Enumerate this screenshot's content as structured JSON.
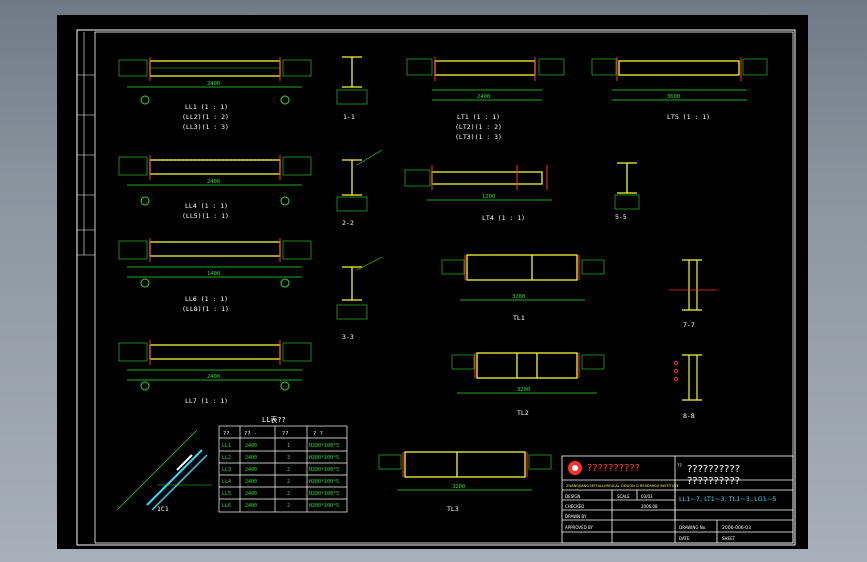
{
  "drawing": {
    "beam_labels": {
      "ll1": "LL1 (1 : 1)",
      "ll2": "(LL2)(1 : 2)",
      "ll3": "(LL3)(1 : 3)",
      "ll4": "LL4 (1 : 1)",
      "ll5": "(LL5)(1 : 1)",
      "ll6": "LL6 (1 : 1)",
      "ll8": "(LL8)(1 : 1)",
      "ll7": "LL7 (1 : 1)",
      "lt1": "LT1 (1 : 1)",
      "lt2": "(LT2)(1 : 2)",
      "lt3": "(LT3)(1 : 3)",
      "lt4": "LT4 (1 : 1)",
      "lt5": "LT5 (1 : 1)"
    },
    "section_labels": {
      "s11": "1-1",
      "s22": "2-2",
      "s33": "3-3",
      "s55": "5-5",
      "s77": "7-7",
      "s88": "8-8"
    },
    "truss_labels": {
      "tl1": "TL1",
      "tl2": "TL2",
      "tl3": "TL3"
    },
    "table": {
      "title": "LL表??",
      "headers": [
        "??",
        "?? -",
        "??",
        "? ?"
      ],
      "rows": [
        [
          "LL1",
          "2400",
          "1",
          "H200*100*5"
        ],
        [
          "LL2",
          "2400",
          "3",
          "H200*100*5"
        ],
        [
          "LL3",
          "2400",
          "2",
          "H200*100*5"
        ],
        [
          "LL4",
          "2400",
          "2",
          "H200*100*5"
        ],
        [
          "LL5",
          "2400",
          "2",
          "H200*100*5"
        ],
        [
          "LL6",
          "2400",
          "2",
          "H200*100*5"
        ]
      ]
    },
    "misc_label": "1C1",
    "dims": {
      "d2400": "2400",
      "d1400": "1400",
      "d1200": "1200",
      "d3200": "3200",
      "d3600": "3600"
    }
  },
  "title_block": {
    "company": "??????????",
    "company_en": "ZHANGJIANG METALLURGICAL DESIGN & RESEARCH INSTITUTE",
    "project": "??????????",
    "project2": "??????????",
    "drawing_title": "LL1~7, LT1~3, TL1~3, LG1~5",
    "drawing_no_label": "DRAWING No.",
    "drawing_no": "2006-006-03",
    "design_label": "DESIGN",
    "check_label": "CHECKED",
    "drawn_label": "DRAWN BY",
    "approved_label": "APPROVED BY",
    "scale_label": "SCALE",
    "date_label": "DATE",
    "date": "2006.08",
    "sheet_label": "SHEET",
    "sheet": "03/03",
    "stage": "??"
  },
  "colors": {
    "green": "#28e028",
    "yellow": "#f5f53a",
    "red": "#ff3030",
    "cyan": "#30d8ff",
    "white": "#ffffff"
  }
}
